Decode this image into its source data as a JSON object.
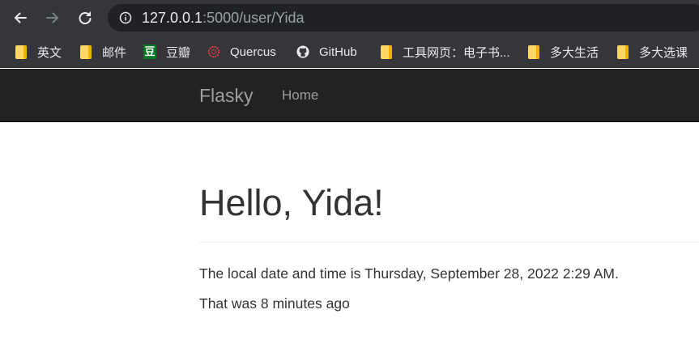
{
  "browser": {
    "url_host": "127.0.0.1",
    "url_path": ":5000/user/Yida",
    "bookmarks": [
      {
        "label": "英文",
        "icon": "folder-icon"
      },
      {
        "label": "邮件",
        "icon": "folder-icon"
      },
      {
        "label": "豆瓣",
        "icon": "douban-icon",
        "icon_text": "豆"
      },
      {
        "label": "Quercus",
        "icon": "quercus-icon"
      },
      {
        "label": "GitHub",
        "icon": "github-icon"
      },
      {
        "label": "工具网页：电子书...",
        "icon": "folder-icon"
      },
      {
        "label": "多大生活",
        "icon": "folder-icon"
      },
      {
        "label": "多大选课",
        "icon": "folder-icon"
      }
    ]
  },
  "navbar": {
    "brand": "Flasky",
    "links": [
      {
        "label": "Home"
      }
    ]
  },
  "content": {
    "heading": "Hello, Yida!",
    "datetime_text": "The local date and time is Thursday, September 28, 2022 2:29 AM.",
    "relative_text": "That was 8 minutes ago"
  },
  "colors": {
    "browser_chrome": "#35363a",
    "omnibox": "#202124",
    "navbar_bg": "#222222",
    "navbar_text": "#9d9d9d",
    "body_text": "#333333"
  }
}
